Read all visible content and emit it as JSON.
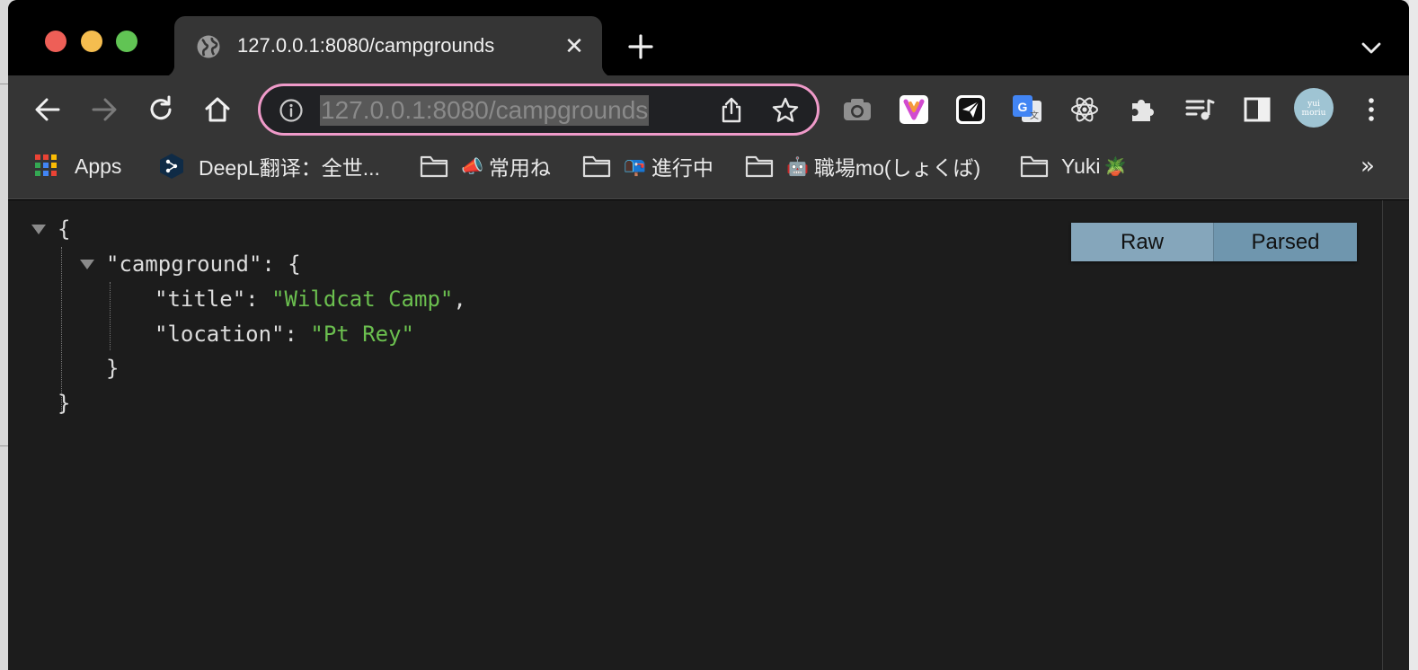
{
  "window": {
    "tab": {
      "title": "127.0.0.1:8080/campgrounds",
      "close_glyph": "✕"
    }
  },
  "toolbar": {
    "url": "127.0.0.1:8080/campgrounds",
    "avatar_text_1": "yui",
    "avatar_text_2": "moriu"
  },
  "bookmarks": {
    "items": [
      {
        "label": "Apps",
        "icon": "apps-grid-icon",
        "prefix": ""
      },
      {
        "label": "DeepL翻译：全世...",
        "icon": "deepl-icon",
        "prefix": ""
      },
      {
        "label": "常用ね",
        "icon": "folder-icon",
        "prefix": "📣"
      },
      {
        "label": "進行中",
        "icon": "folder-icon",
        "prefix": "📭"
      },
      {
        "label": "職場mo(しょくば)",
        "icon": "folder-icon",
        "prefix": "🤖"
      },
      {
        "label": "Yuki",
        "icon": "folder-icon",
        "prefix": "",
        "suffix": "🪴"
      }
    ],
    "more": "»"
  },
  "json_viewer": {
    "open_brace": "{",
    "close_brace": "}",
    "key_campground": "\"campground\"",
    "colon_brace": ": {",
    "key_title": "\"title\"",
    "value_title": "\"Wildcat Camp\"",
    "key_location": "\"location\"",
    "value_location": "\"Pt Rey\"",
    "colon": ": ",
    "comma": ",",
    "toggle": {
      "raw": "Raw",
      "parsed": "Parsed"
    }
  }
}
